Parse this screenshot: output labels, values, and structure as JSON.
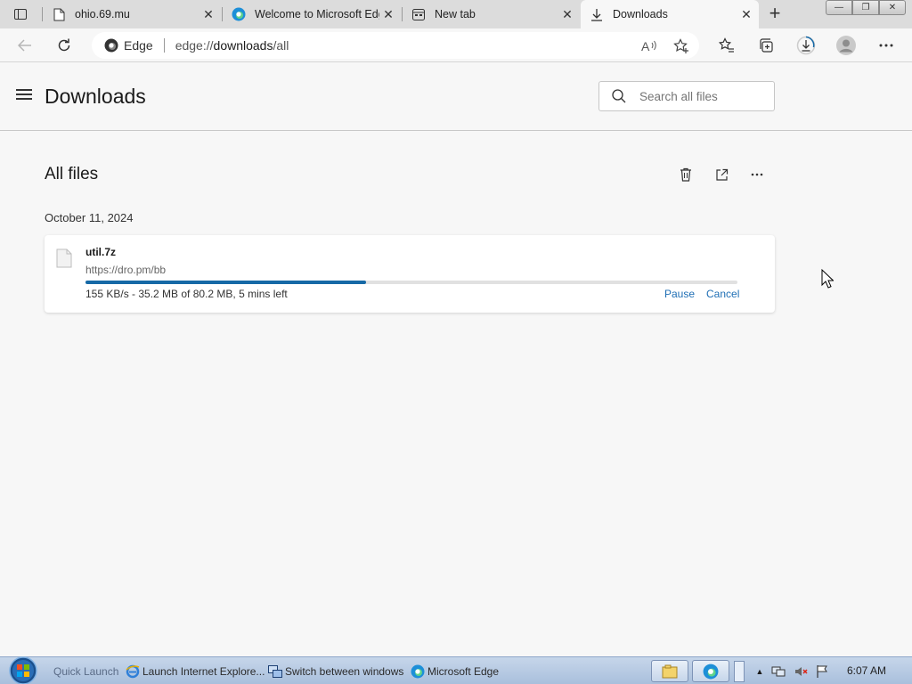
{
  "browser": {
    "tabs": [
      {
        "title": "ohio.69.mu",
        "icon": "page-icon",
        "close": "✕"
      },
      {
        "title": "Welcome to Microsoft Edge",
        "icon": "edge-icon",
        "close": "✕"
      },
      {
        "title": "New tab",
        "icon": "newtab-icon",
        "close": "✕"
      },
      {
        "title": "Downloads",
        "icon": "download-icon",
        "close": "✕",
        "active": true
      }
    ],
    "newtab_label": "+",
    "window_controls": {
      "minimize": "—",
      "restore": "❐",
      "close": "✕"
    },
    "address": {
      "site_label": "Edge",
      "url_prefix": "edge://",
      "url_bold": "downloads",
      "url_suffix": "/all"
    }
  },
  "page": {
    "title": "Downloads",
    "search": {
      "placeholder": "Search all files"
    },
    "section_title": "All files",
    "date_group": "October 11, 2024",
    "download": {
      "file_name": "util.7z",
      "source_url": "https://dro.pm/bb",
      "progress_fraction": 0.43,
      "status": "155 KB/s - 35.2 MB of 80.2 MB, 5 mins left",
      "pause_label": "Pause",
      "cancel_label": "Cancel"
    }
  },
  "taskbar": {
    "quick_launch": "Quick Launch",
    "items": [
      {
        "label": "Launch Internet Explore...",
        "icon": "ie-icon"
      },
      {
        "label": "Switch between windows",
        "icon": "switch-windows-icon"
      },
      {
        "label": "Microsoft Edge",
        "icon": "edge-icon"
      }
    ],
    "clock": "6:07 AM"
  },
  "colors": {
    "accent": "#1f6fb5",
    "progress": "#1669a6",
    "background": "#f7f7f7",
    "tabstrip": "#dcdcdc"
  }
}
